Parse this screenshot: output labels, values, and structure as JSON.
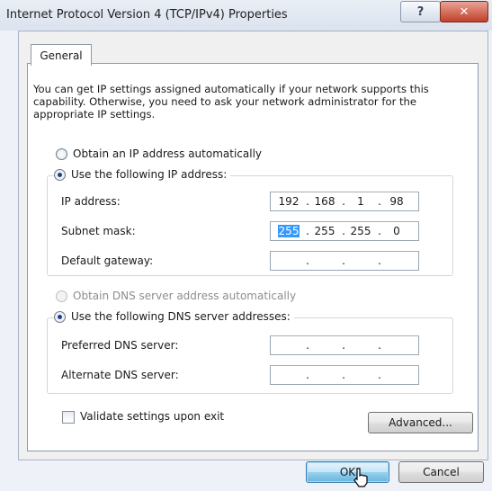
{
  "window": {
    "title": "Internet Protocol Version 4 (TCP/IPv4) Properties",
    "help_glyph": "?",
    "close_glyph": "✕"
  },
  "tabs": [
    {
      "label": "General",
      "active": true
    }
  ],
  "intro": "You can get IP settings assigned automatically if your network supports this capability. Otherwise, you need to ask your network administrator for the appropriate IP settings.",
  "ip_section": {
    "auto_label": "Obtain an IP address automatically",
    "manual_label": "Use the following IP address:",
    "selected": "manual",
    "fields": [
      {
        "label": "IP address:",
        "octets": [
          "192",
          "168",
          "1",
          "98"
        ]
      },
      {
        "label": "Subnet mask:",
        "octets": [
          "255",
          "255",
          "255",
          "0"
        ],
        "selected_octet": 0
      },
      {
        "label": "Default gateway:",
        "octets": [
          "",
          "",
          "",
          ""
        ]
      }
    ]
  },
  "dns_section": {
    "auto_label": "Obtain DNS server address automatically",
    "manual_label": "Use the following DNS server addresses:",
    "selected": "manual",
    "auto_disabled": true,
    "fields": [
      {
        "label": "Preferred DNS server:",
        "octets": [
          "",
          "",
          "",
          ""
        ]
      },
      {
        "label": "Alternate DNS server:",
        "octets": [
          "",
          "",
          "",
          ""
        ]
      }
    ]
  },
  "validate": {
    "label": "Validate settings upon exit",
    "checked": false
  },
  "buttons": {
    "advanced": "Advanced...",
    "ok": "OK",
    "cancel": "Cancel"
  },
  "colors": {
    "selection": "#3399ff",
    "title_bar": "#dbe3ef",
    "close_button": "#c1402a"
  }
}
